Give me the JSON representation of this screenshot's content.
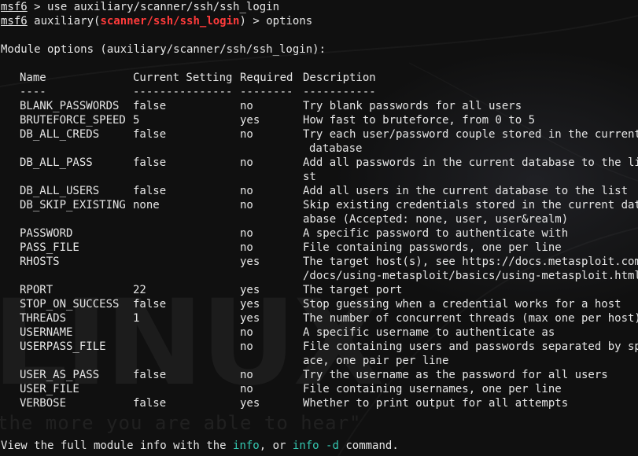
{
  "prompt": {
    "name": "msf6",
    "arrow": ">",
    "command_1": "use auxiliary/scanner/ssh/ssh_login",
    "module_prefix": "auxiliary(",
    "module_path": "scanner/ssh/ssh_login",
    "module_suffix": ")",
    "command_2": "options"
  },
  "heading": "Module options (auxiliary/scanner/ssh/ssh_login):",
  "table": {
    "headers": {
      "name": "Name",
      "setting": "Current Setting",
      "required": "Required",
      "description": "Description"
    },
    "underlines": {
      "name": "----",
      "setting": "---------------",
      "required": "--------",
      "description": "-----------"
    },
    "rows": [
      {
        "name": "BLANK_PASSWORDS",
        "setting": "false",
        "required": "no",
        "description": "Try blank passwords for all users",
        "description_cont": ""
      },
      {
        "name": "BRUTEFORCE_SPEED",
        "setting": "5",
        "required": "yes",
        "description": "How fast to bruteforce, from 0 to 5",
        "description_cont": ""
      },
      {
        "name": "DB_ALL_CREDS",
        "setting": "false",
        "required": "no",
        "description": "Try each user/password couple stored in the current",
        "description_cont": "database"
      },
      {
        "name": "DB_ALL_PASS",
        "setting": "false",
        "required": "no",
        "description": "Add all passwords in the current database to the li",
        "description_cont": "st"
      },
      {
        "name": "DB_ALL_USERS",
        "setting": "false",
        "required": "no",
        "description": "Add all users in the current database to the list",
        "description_cont": ""
      },
      {
        "name": "DB_SKIP_EXISTING",
        "setting": "none",
        "required": "no",
        "description": "Skip existing credentials stored in the current dat",
        "description_cont": "abase (Accepted: none, user, user&realm)"
      },
      {
        "name": "PASSWORD",
        "setting": "",
        "required": "no",
        "description": "A specific password to authenticate with",
        "description_cont": ""
      },
      {
        "name": "PASS_FILE",
        "setting": "",
        "required": "no",
        "description": "File containing passwords, one per line",
        "description_cont": ""
      },
      {
        "name": "RHOSTS",
        "setting": "",
        "required": "yes",
        "description": "The target host(s), see https://docs.metasploit.com",
        "description_cont": "/docs/using-metasploit/basics/using-metasploit.html"
      },
      {
        "name": "RPORT",
        "setting": "22",
        "required": "yes",
        "description": "The target port",
        "description_cont": ""
      },
      {
        "name": "STOP_ON_SUCCESS",
        "setting": "false",
        "required": "yes",
        "description": "Stop guessing when a credential works for a host",
        "description_cont": ""
      },
      {
        "name": "THREADS",
        "setting": "1",
        "required": "yes",
        "description": "The number of concurrent threads (max one per host)",
        "description_cont": ""
      },
      {
        "name": "USERNAME",
        "setting": "",
        "required": "no",
        "description": "A specific username to authenticate as",
        "description_cont": ""
      },
      {
        "name": "USERPASS_FILE",
        "setting": "",
        "required": "no",
        "description": "File containing users and passwords separated by sp",
        "description_cont": "ace, one pair per line"
      },
      {
        "name": "USER_AS_PASS",
        "setting": "false",
        "required": "no",
        "description": "Try the username as the password for all users",
        "description_cont": ""
      },
      {
        "name": "USER_FILE",
        "setting": "",
        "required": "no",
        "description": "File containing usernames, one per line",
        "description_cont": ""
      },
      {
        "name": "VERBOSE",
        "setting": "false",
        "required": "yes",
        "description": "Whether to print output for all attempts",
        "description_cont": ""
      }
    ]
  },
  "footer": {
    "prefix": "View the full module info with the ",
    "cmd_info": "info",
    "middle": ", or ",
    "cmd_info_d": "info -d",
    "suffix": " command."
  },
  "background": {
    "logo_text": "LINUX",
    "tagline": "the more you are able to hear\""
  },
  "colors": {
    "background": "#101010",
    "text": "#e6e6e6",
    "module_highlight": "#ff3b3b",
    "command_highlight": "#34c7b0"
  }
}
